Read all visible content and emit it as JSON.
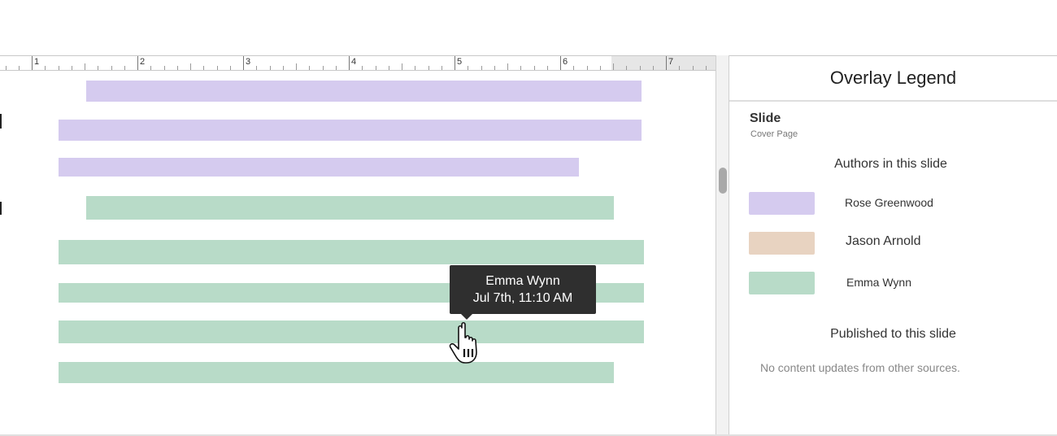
{
  "ruler": {
    "numbers": [
      "1",
      "2",
      "3",
      "4",
      "5",
      "6",
      "7"
    ]
  },
  "document": {
    "bars": [
      {
        "author": "Rose Greenwood",
        "color": "#d5cbef"
      },
      {
        "author": "Rose Greenwood",
        "color": "#d5cbef"
      },
      {
        "author": "Rose Greenwood",
        "color": "#d5cbef"
      },
      {
        "author": "Emma Wynn",
        "color": "#b8dbc8"
      },
      {
        "author": "Emma Wynn",
        "color": "#b8dbc8"
      },
      {
        "author": "Emma Wynn",
        "color": "#b8dbc8"
      },
      {
        "author": "Emma Wynn",
        "color": "#b8dbc8"
      },
      {
        "author": "Emma Wynn",
        "color": "#b8dbc8"
      }
    ]
  },
  "tooltip": {
    "name": "Emma Wynn",
    "time": "Jul 7th, 11:10 AM"
  },
  "cursor": {
    "icon": "hand-pointer-icon"
  },
  "panel": {
    "title": "Overlay Legend",
    "slide_label": "Slide",
    "slide_name": "Cover Page",
    "authors_title": "Authors in this slide",
    "authors": [
      {
        "name": "Rose Greenwood",
        "color": "#d5cbef"
      },
      {
        "name": "Jason Arnold",
        "color": "#e8d3c1"
      },
      {
        "name": "Emma Wynn",
        "color": "#b8dbc8"
      }
    ],
    "published_title": "Published to this slide",
    "published_empty": "No content updates from other sources."
  }
}
